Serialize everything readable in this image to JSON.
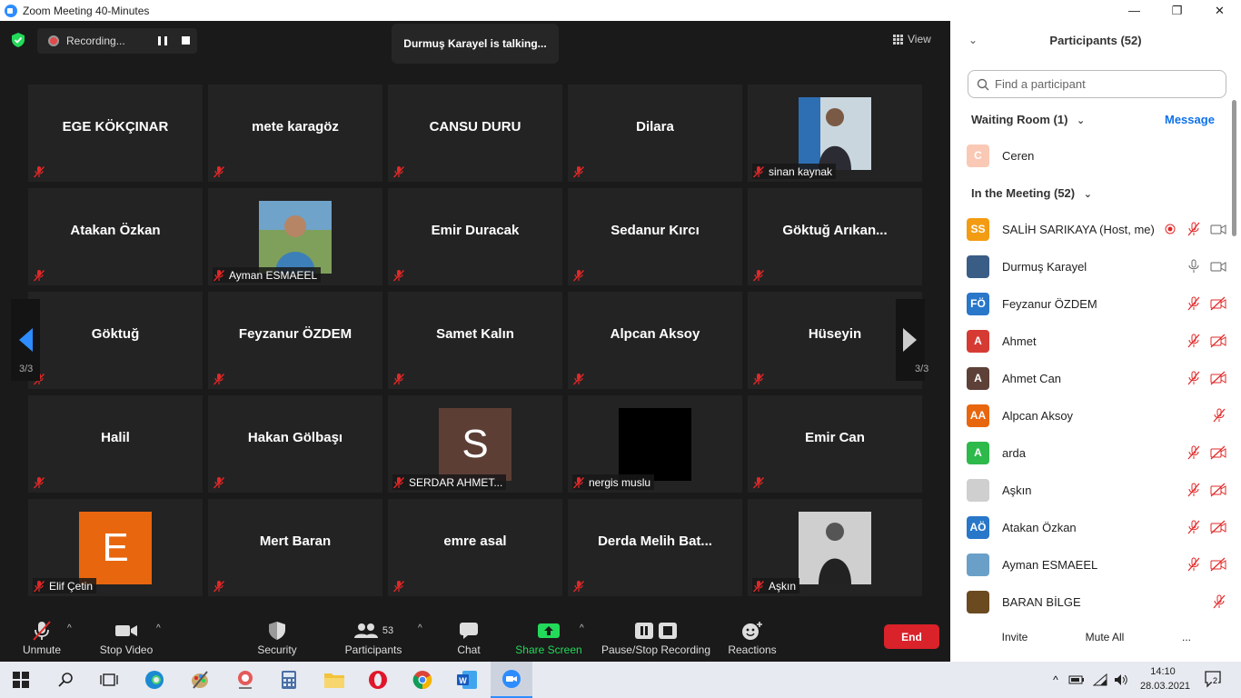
{
  "window": {
    "title": "Zoom Meeting 40-Minutes",
    "minimize": "—",
    "maximize": "❐",
    "close": "✕"
  },
  "top": {
    "recording": "Recording...",
    "talking": "Durmuş Karayel is talking...",
    "view": "View"
  },
  "tiles": [
    [
      "EGE KÖKÇINAR",
      "mete karagöz",
      "CANSU DURU",
      "Dilara",
      "sinan kaynak"
    ],
    [
      "Atakan Özkan",
      "Ayman ESMAEEL",
      "Emir Duracak",
      "Sedanur Kırcı",
      "Göktuğ  Arıkan..."
    ],
    [
      "Göktuğ",
      "Feyzanur ÖZDEM",
      "Samet Kalın",
      "Alpcan Aksoy",
      "Hüseyin"
    ],
    [
      "Halil",
      "Hakan Gölbaşı",
      "SERDAR AHMET...",
      "nergis muslu",
      "Emir Can"
    ],
    [
      "Elif Çetin",
      "Mert Baran",
      "emre asal",
      "Derda  Melih  Bat...",
      "Aşkın"
    ]
  ],
  "tile_avatars": {
    "serdar": "S",
    "elif": "E"
  },
  "page_indicator": "3/3",
  "toolbar": {
    "unmute": "Unmute",
    "stop_video": "Stop Video",
    "security": "Security",
    "participants": "Participants",
    "participants_count": "53",
    "chat": "Chat",
    "share_screen": "Share Screen",
    "pause_stop_recording": "Pause/Stop Recording",
    "reactions": "Reactions",
    "end": "End"
  },
  "panel": {
    "title": "Participants (52)",
    "search_placeholder": "Find a participant",
    "waiting_room": "Waiting Room (1)",
    "message": "Message",
    "waiting": [
      {
        "initial": "C",
        "name": "Ceren",
        "color": "#f9c9b6"
      }
    ],
    "in_meeting": "In the Meeting (52)",
    "participants": [
      {
        "initial": "SS",
        "name": "SALİH SARIKAYA (Host, me)",
        "color": "#f39c12"
      },
      {
        "initial": "",
        "name": "Durmuş Karayel",
        "color": "#3a5d86"
      },
      {
        "initial": "FÖ",
        "name": " Feyzanur ÖZDEM",
        "color": "#2877c9"
      },
      {
        "initial": "A",
        "name": "Ahmet",
        "color": "#d63b33"
      },
      {
        "initial": "A",
        "name": "Ahmet Can",
        "color": "#5d4037"
      },
      {
        "initial": "AA",
        "name": "Alpcan Aksoy",
        "color": "#e8660d"
      },
      {
        "initial": "A",
        "name": "arda",
        "color": "#2eb94b"
      },
      {
        "initial": "",
        "name": "Aşkın",
        "color": "#cfcfcf"
      },
      {
        "initial": "AÖ",
        "name": "Atakan Özkan",
        "color": "#2877c9"
      },
      {
        "initial": "",
        "name": "Ayman ESMAEEL",
        "color": "#6aa0c8"
      },
      {
        "initial": "",
        "name": "BARAN BİLGE",
        "color": "#6b4a1f"
      }
    ],
    "invite": "Invite",
    "mute_all": "Mute All",
    "more": "..."
  },
  "taskbar": {
    "time": "14:10",
    "date": "28.03.2021",
    "notifications": "2"
  }
}
